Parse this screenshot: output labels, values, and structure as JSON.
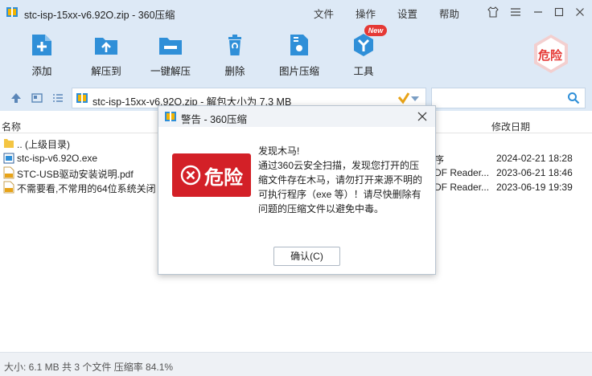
{
  "window": {
    "title": "stc-isp-15xx-v6.92O.zip - 360压缩",
    "menu": [
      "文件",
      "操作",
      "设置",
      "帮助"
    ]
  },
  "toolbar": {
    "items": [
      {
        "label": "添加",
        "icon": "add-icon"
      },
      {
        "label": "解压到",
        "icon": "extract-to-icon"
      },
      {
        "label": "一键解压",
        "icon": "one-click-extract-icon"
      },
      {
        "label": "删除",
        "icon": "delete-icon"
      },
      {
        "label": "图片压缩",
        "icon": "image-compress-icon"
      },
      {
        "label": "工具",
        "icon": "tools-icon"
      }
    ],
    "new_badge": "New",
    "danger_label": "危险"
  },
  "address": {
    "text": "stc-isp-15xx-v6.92O.zip - 解包大小为 7.3 MB"
  },
  "file_list": {
    "columns": {
      "name": "名称",
      "modified": "修改日期"
    },
    "rows": [
      {
        "name": ".. (上级目录)",
        "type": "",
        "date": "",
        "icon": "folder-icon"
      },
      {
        "name": "stc-isp-v6.92O.exe",
        "type": "序",
        "date": "2024-02-21 18:28",
        "icon": "exe-icon"
      },
      {
        "name": "STC-USB驱动安装说明.pdf",
        "type": "DF Reader...",
        "date": "2023-06-21 18:46",
        "icon": "pdf-icon"
      },
      {
        "name": "不需要看,不常用的64位系统关闭",
        "type": "DF Reader...",
        "date": "2023-06-19 19:39",
        "icon": "pdf-icon"
      }
    ]
  },
  "status": {
    "text": "大小: 6.1 MB 共 3 个文件 压缩率 84.1%"
  },
  "dialog": {
    "title": "警告 - 360压缩",
    "badge_text": "危险",
    "message_lines": [
      "发现木马!",
      "通过360云安全扫描，发现您打开的压",
      "缩文件存在木马，请勿打开来源不明的",
      "可执行程序（exe 等）！请尽快删除有",
      "问题的压缩文件以避免中毒。"
    ],
    "ok_button": "确认(C)"
  },
  "colors": {
    "toolbar_bg": "#dde9f6",
    "accent_blue": "#2f8fd8",
    "danger_red": "#d32027"
  }
}
